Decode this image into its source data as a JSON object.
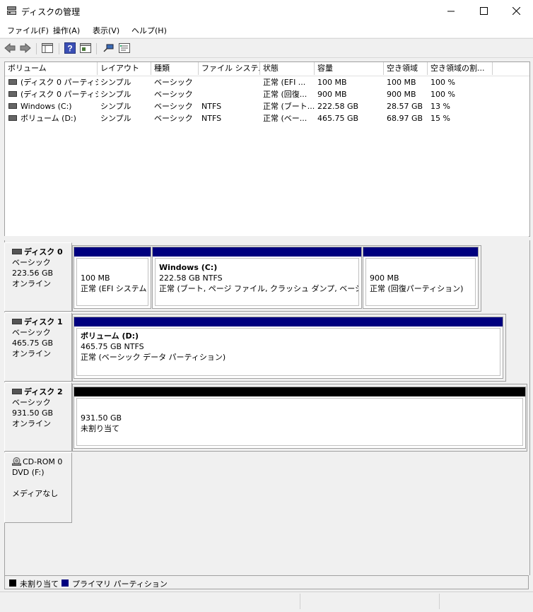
{
  "window": {
    "title": "ディスクの管理",
    "icon": "disk-management-icon",
    "controls": [
      "minimize-icon",
      "maximize-icon",
      "close-icon"
    ]
  },
  "menu": [
    {
      "label": "ファイル(F)"
    },
    {
      "label": "操作(A)"
    },
    {
      "label": "表示(V)"
    },
    {
      "label": "ヘルプ(H)"
    }
  ],
  "toolbar": [
    "back-arrow-icon",
    "forward-arrow-icon",
    "console-tree-icon",
    "help-icon",
    "action-pane-icon",
    "connect-icon",
    "properties-icon"
  ],
  "list": {
    "columns": [
      "ボリューム",
      "レイアウト",
      "種類",
      "ファイル システム",
      "状態",
      "容量",
      "空き領域",
      "空き領域の割..."
    ],
    "rows": [
      {
        "volume": "(ディスク 0 パーティシ...",
        "layout": "シンプル",
        "type": "ベーシック",
        "fs": "",
        "status": "正常 (EFI ...",
        "capacity": "100 MB",
        "free": "100 MB",
        "pct": "100 %"
      },
      {
        "volume": "(ディスク 0 パーティシ...",
        "layout": "シンプル",
        "type": "ベーシック",
        "fs": "",
        "status": "正常 (回復...",
        "capacity": "900 MB",
        "free": "900 MB",
        "pct": "100 %"
      },
      {
        "volume": "Windows (C:)",
        "layout": "シンプル",
        "type": "ベーシック",
        "fs": "NTFS",
        "status": "正常 (ブート...",
        "capacity": "222.58 GB",
        "free": "28.57 GB",
        "pct": "13 %"
      },
      {
        "volume": "ボリューム (D:)",
        "layout": "シンプル",
        "type": "ベーシック",
        "fs": "NTFS",
        "status": "正常 (ベー...",
        "capacity": "465.75 GB",
        "free": "68.97 GB",
        "pct": "15 %"
      }
    ]
  },
  "disks": [
    {
      "name": "ディスク 0",
      "type": "ベーシック",
      "size": "223.56 GB",
      "state": "オンライン",
      "partitions": [
        {
          "title": "",
          "size": "100 MB",
          "status": "正常 (EFI システム パ"
        },
        {
          "title": "Windows  (C:)",
          "size": "222.58 GB NTFS",
          "status": "正常 (ブート, ページ ファイル, クラッシュ ダンプ, ベーシック データ"
        },
        {
          "title": "",
          "size": "900 MB",
          "status": "正常 (回復パーティション)"
        }
      ]
    },
    {
      "name": "ディスク 1",
      "type": "ベーシック",
      "size": "465.75 GB",
      "state": "オンライン",
      "partitions": [
        {
          "title": "ボリューム  (D:)",
          "size": "465.75 GB NTFS",
          "status": "正常 (ベーシック データ パーティション)"
        }
      ]
    },
    {
      "name": "ディスク 2",
      "type": "ベーシック",
      "size": "931.50 GB",
      "state": "オンライン",
      "partitions": [
        {
          "title": "",
          "size": "931.50 GB",
          "status": "未割り当て"
        }
      ]
    },
    {
      "name": "CD-ROM 0",
      "type": "DVD (F:)",
      "size": "",
      "state": "メディアなし"
    }
  ],
  "legend": [
    {
      "label": "未割り当て",
      "color": "#000000"
    },
    {
      "label": "プライマリ パーティション",
      "color": "#00007f"
    }
  ]
}
